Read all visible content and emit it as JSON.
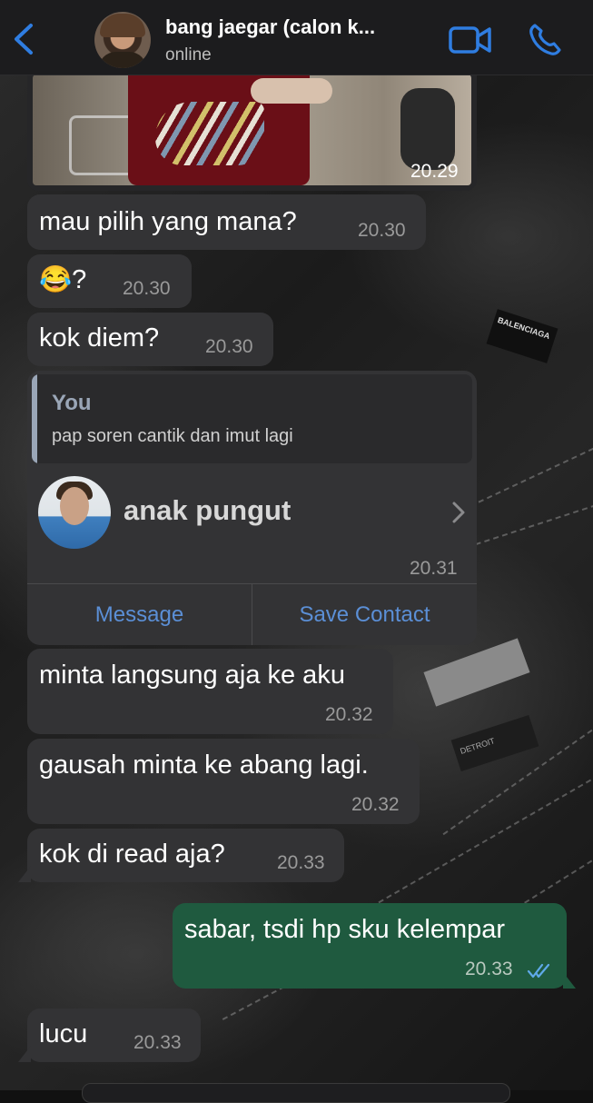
{
  "header": {
    "back_icon": "chevron-left-icon",
    "contact_name": "bang jaegar (calon k...",
    "status": "online",
    "video_icon": "video-camera-icon",
    "phone_icon": "phone-icon",
    "accent_color": "#2f7de1"
  },
  "photo_message": {
    "time": "20.29"
  },
  "messages": [
    {
      "direction": "in",
      "text": "mau pilih yang mana?",
      "time": "20.30"
    },
    {
      "direction": "in",
      "text": "😂?",
      "time": "20.30"
    },
    {
      "direction": "in",
      "text": "kok diem?",
      "time": "20.30"
    }
  ],
  "contact_card": {
    "quote_author": "You",
    "quote_text": "pap soren cantik dan imut lagi",
    "contact_name": "anak pungut",
    "time": "20.31",
    "message_label": "Message",
    "save_label": "Save Contact"
  },
  "messages2": [
    {
      "direction": "in",
      "text": "minta langsung aja ke aku",
      "time": "20.32"
    },
    {
      "direction": "in",
      "text": "gausah minta ke abang lagi.",
      "time": "20.32"
    },
    {
      "direction": "in",
      "text": "kok di read aja?",
      "time": "20.33"
    },
    {
      "direction": "out",
      "text": "sabar, tsdi hp sku kelempar",
      "time": "20.33",
      "status": "read",
      "status_icon": "double-check-icon"
    },
    {
      "direction": "in",
      "text": "lucu",
      "time": "20.33"
    }
  ],
  "colors": {
    "incoming_bubble": "#333335",
    "outgoing_bubble": "#1f5a3f",
    "link": "#5b8fd6",
    "read_check": "#5fa9e8"
  }
}
